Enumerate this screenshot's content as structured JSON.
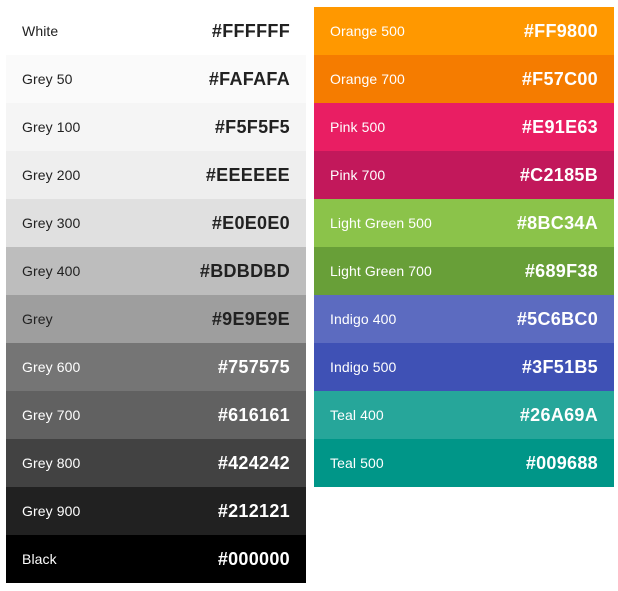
{
  "left_palette": [
    {
      "name": "White",
      "hex": "#FFFFFF",
      "bg": "#FFFFFF",
      "fg": "#212121"
    },
    {
      "name": "Grey 50",
      "hex": "#FAFAFA",
      "bg": "#FAFAFA",
      "fg": "#212121"
    },
    {
      "name": "Grey 100",
      "hex": "#F5F5F5",
      "bg": "#F5F5F5",
      "fg": "#212121"
    },
    {
      "name": "Grey 200",
      "hex": "#EEEEEE",
      "bg": "#EEEEEE",
      "fg": "#212121"
    },
    {
      "name": "Grey 300",
      "hex": "#E0E0E0",
      "bg": "#E0E0E0",
      "fg": "#212121"
    },
    {
      "name": "Grey 400",
      "hex": "#BDBDBD",
      "bg": "#BDBDBD",
      "fg": "#212121"
    },
    {
      "name": "Grey",
      "hex": "#9E9E9E",
      "bg": "#9E9E9E",
      "fg": "#212121"
    },
    {
      "name": "Grey 600",
      "hex": "#757575",
      "bg": "#757575",
      "fg": "#FFFFFF"
    },
    {
      "name": "Grey 700",
      "hex": "#616161",
      "bg": "#616161",
      "fg": "#FFFFFF"
    },
    {
      "name": "Grey 800",
      "hex": "#424242",
      "bg": "#424242",
      "fg": "#FFFFFF"
    },
    {
      "name": "Grey 900",
      "hex": "#212121",
      "bg": "#212121",
      "fg": "#FFFFFF"
    },
    {
      "name": "Black",
      "hex": "#000000",
      "bg": "#000000",
      "fg": "#FFFFFF"
    }
  ],
  "right_palette": [
    {
      "name": "Orange 500",
      "hex": "#FF9800",
      "bg": "#FF9800",
      "fg": "#FFFFFF"
    },
    {
      "name": "Orange 700",
      "hex": "#F57C00",
      "bg": "#F57C00",
      "fg": "#FFFFFF"
    },
    {
      "name": "Pink 500",
      "hex": "#E91E63",
      "bg": "#E91E63",
      "fg": "#FFFFFF"
    },
    {
      "name": "Pink 700",
      "hex": "#C2185B",
      "bg": "#C2185B",
      "fg": "#FFFFFF"
    },
    {
      "name": "Light Green 500",
      "hex": "#8BC34A",
      "bg": "#8BC34A",
      "fg": "#FFFFFF"
    },
    {
      "name": "Light Green 700",
      "hex": "#689F38",
      "bg": "#689F38",
      "fg": "#FFFFFF"
    },
    {
      "name": "Indigo 400",
      "hex": "#5C6BC0",
      "bg": "#5C6BC0",
      "fg": "#FFFFFF"
    },
    {
      "name": "Indigo 500",
      "hex": "#3F51B5",
      "bg": "#3F51B5",
      "fg": "#FFFFFF"
    },
    {
      "name": "Teal 400",
      "hex": "#26A69A",
      "bg": "#26A69A",
      "fg": "#FFFFFF"
    },
    {
      "name": "Teal 500",
      "hex": "#009688",
      "bg": "#009688",
      "fg": "#FFFFFF"
    }
  ]
}
